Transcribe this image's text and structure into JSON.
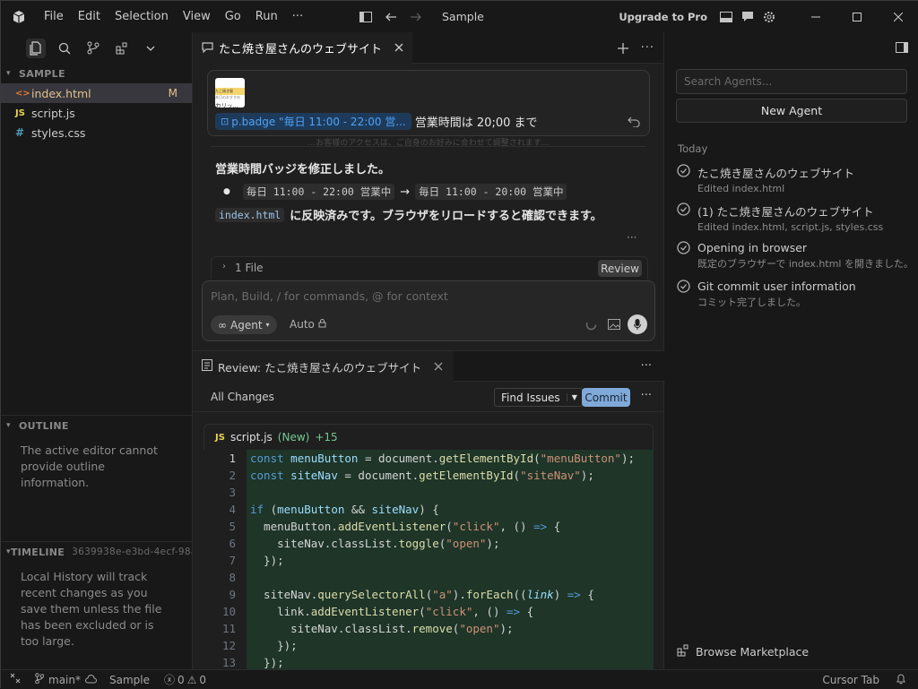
{
  "titlebar": {
    "menu": [
      "File",
      "Edit",
      "Selection",
      "View",
      "Go",
      "Run",
      "···"
    ],
    "title": "Sample",
    "upgrade": "Upgrade to Pro"
  },
  "sidebar": {
    "explorer_title": "SAMPLE",
    "files": [
      {
        "icon": "<>",
        "name": "index.html",
        "status": "M"
      },
      {
        "icon": "JS",
        "name": "script.js",
        "status": ""
      },
      {
        "icon": "#",
        "name": "styles.css",
        "status": ""
      }
    ],
    "outline_title": "OUTLINE",
    "outline_text": "The active editor cannot provide outline information.",
    "timeline_title": "TIMELINE",
    "timeline_id": "3639938e-e3bd-4ecf-98a...",
    "timeline_text": "Local History will track recent changes as you save them unless the file has been excluded or is too large."
  },
  "chat": {
    "tab_title": "たこ焼き屋さんのウェブサイト",
    "thumb_text1": "たこ焼き屋",
    "thumb_text2": "本日のおすすめ",
    "thumb_text3": "カリッ...",
    "badge_chip": "p.badge \"毎日 11:00 - 22:00 営...",
    "user_message": "営業時間は 20;00 まで",
    "faded_text": "…お客様のアクセスは、ご自身のお好みに合わせて調整されます…",
    "reply_title": "営業時間バッジを修正しました。",
    "change_from": "毎日 11:00 - 22:00 営業中",
    "arrow": "→",
    "change_to": "毎日 11:00 - 20:00 営業中",
    "file_code": "index.html",
    "reply_tail": "に反映済みです。ブラウザをリロードすると確認できます。",
    "more": "···",
    "files_count": "1 File",
    "review_btn": "Review",
    "input_placeholder": "Plan, Build, / for commands, @ for context",
    "agent_label": "Agent",
    "auto_label": "Auto"
  },
  "review": {
    "tab_title": "Review: たこ焼き屋さんのウェブサイト",
    "all_changes": "All Changes",
    "find_issues": "Find Issues",
    "commit": "Commit",
    "file_icon": "JS",
    "file_name": "script.js",
    "file_new": "(New)",
    "file_added": "+15"
  },
  "code_lines": [
    {
      "n": "1"
    },
    {
      "n": "2"
    },
    {
      "n": "3"
    },
    {
      "n": "4"
    },
    {
      "n": "5"
    },
    {
      "n": "6"
    },
    {
      "n": "7"
    },
    {
      "n": "8"
    },
    {
      "n": "9"
    },
    {
      "n": "10"
    },
    {
      "n": "11"
    },
    {
      "n": "12"
    },
    {
      "n": "13"
    }
  ],
  "agents_panel": {
    "search_placeholder": "Search Agents...",
    "new_agent": "New Agent",
    "today": "Today",
    "items": [
      {
        "title": "たこ焼き屋さんのウェブサイト",
        "sub": "Edited index.html"
      },
      {
        "title": "(1) たこ焼き屋さんのウェブサイト",
        "sub": "Edited index.html, script.js, styles.css"
      },
      {
        "title": "Opening in browser",
        "sub": "既定のブラウザーで index.html を開きました。"
      },
      {
        "title": "Git commit user information",
        "sub": "コミット完了しました。"
      }
    ],
    "marketplace": "Browse Marketplace"
  },
  "statusbar": {
    "branch": "main*",
    "workspace": "Sample",
    "errors": "0",
    "warnings": "0",
    "cursor_tab": "Cursor Tab"
  },
  "colors": {
    "accent": "#4ea3f5",
    "commit": "#7fa9d9",
    "modified": "#e2c08d",
    "diff_bg": "#1e3528"
  }
}
